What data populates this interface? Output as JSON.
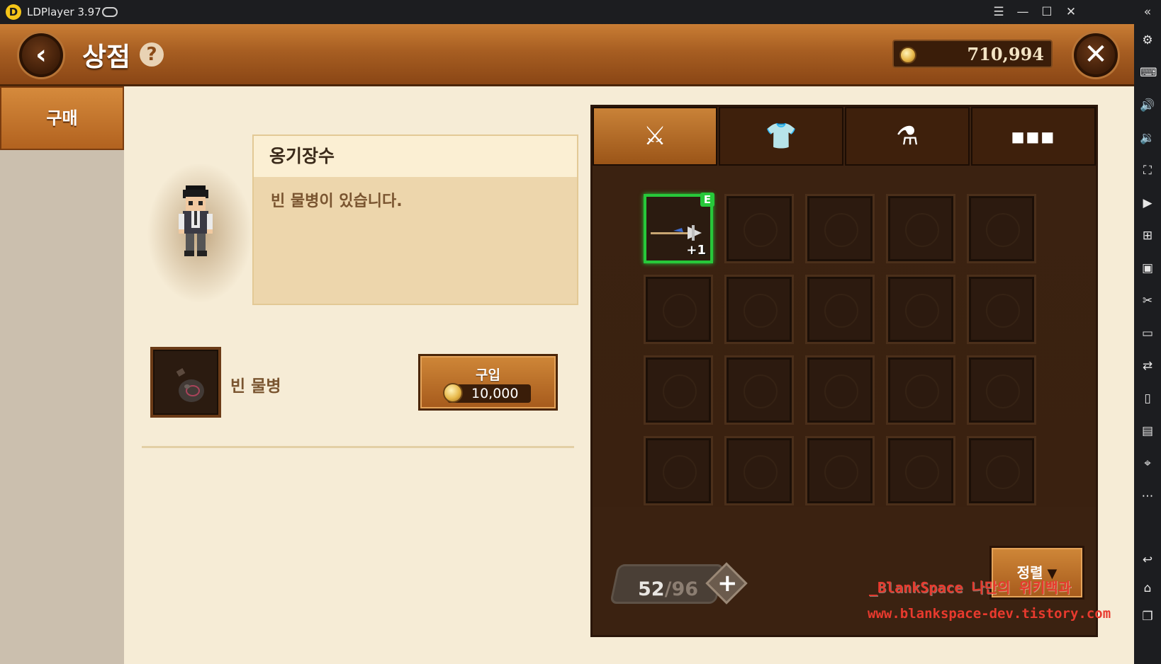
{
  "titlebar": {
    "app_title": "LDPlayer 3.97",
    "buttons": [
      "menu-icon",
      "minimize-icon",
      "maximize-icon",
      "close-icon",
      "collapse-icon"
    ]
  },
  "header": {
    "title": "상점",
    "help": "?",
    "gold": "710,994",
    "back_glyph": "‹",
    "close_glyph": "✕"
  },
  "sidebar": {
    "tabs": [
      {
        "label": "구매",
        "active": true
      }
    ]
  },
  "detail": {
    "npc_name": "옹기장수",
    "description": "빈 물병이 있습니다."
  },
  "shop_items": [
    {
      "name": "빈 물병",
      "buy_label": "구입",
      "price": "10,000"
    }
  ],
  "inventory": {
    "tabs": [
      {
        "icon": "crossed-swords-icon",
        "glyph": "⚔",
        "active": true
      },
      {
        "icon": "armor-icon",
        "glyph": "👕",
        "active": false
      },
      {
        "icon": "potion-flask-icon",
        "glyph": "⚗",
        "active": false
      },
      {
        "icon": "more-icon",
        "glyph": "■■■",
        "active": false
      }
    ],
    "equipped_item": {
      "equip_tag": "E",
      "enhancement": "+1"
    },
    "capacity_used": "52",
    "capacity_total": "/96",
    "add_glyph": "+",
    "sort_label": "정렬",
    "sort_arrow": "▼"
  },
  "watermark": {
    "line1": "_BlankSpace 나만의 위키백과",
    "line2": "www.blankspace-dev.tistory.com"
  },
  "colors": {
    "header_brown": "#a75e22",
    "panel_dark": "#3b2211",
    "equipped_green": "#27c83a",
    "watermark_red": "#e83a2e"
  }
}
